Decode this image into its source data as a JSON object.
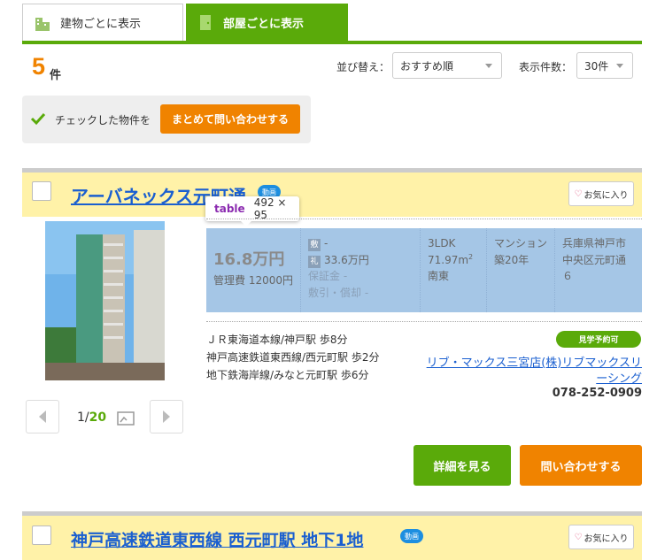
{
  "tabs": [
    {
      "label": "建物ごとに表示",
      "icon": "building-icon",
      "active": false
    },
    {
      "label": "部屋ごとに表示",
      "icon": "door-icon",
      "active": true
    }
  ],
  "result": {
    "count": "5",
    "unit": "件"
  },
  "sort": {
    "label": "並び替え：",
    "value": "おすすめ順"
  },
  "per_page": {
    "label": "表示件数：",
    "value": "30件"
  },
  "bulk": {
    "text": "チェックした物件を",
    "button": "まとめて問い合わせする"
  },
  "listings": [
    {
      "title": "アーバネックス元町通",
      "video_badge": "動画",
      "favorite": "お気に入り",
      "photo_counter": {
        "current": "1/",
        "total": "20"
      },
      "rent": "16.8万円",
      "management_fee": "管理費 12000円",
      "deposit_label": "敷",
      "deposit": "-",
      "key_money_label": "礼",
      "key_money": "33.6万円",
      "guarantee": "保証金 -",
      "deduction": "敷引・償却 -",
      "layout": "3LDK",
      "area": "71.97m",
      "area_sup": "2",
      "direction": "南東",
      "building_type": "マンション",
      "age": "築20年",
      "address": "兵庫県神戸市中央区元町通６",
      "access": [
        "ＪＲ東海道本線/神戸駅 歩8分",
        "神戸高速鉄道東西線/西元町駅 歩2分",
        "地下鉄海岸線/みなと元町駅 歩6分"
      ],
      "visit_badge": "見学予約可",
      "agency": "リブ・マックス三宮店(株)リブマックスリーシング",
      "phone": "078-252-0909",
      "detail_button": "詳細を見る",
      "inquiry_button": "問い合わせする"
    },
    {
      "title": "神戸高速鉄道東西線 西元町駅 地下1地",
      "video_badge": "動画",
      "favorite": "お気に入り"
    }
  ],
  "tooltip": {
    "tag": "table",
    "size": "492 × 95"
  },
  "colors": {
    "green": "#5aaa0a",
    "orange": "#f08300",
    "title_blue": "#1a5fd0",
    "header_yellow": "#fff2a8",
    "table_highlight": "#a5c6e6"
  }
}
